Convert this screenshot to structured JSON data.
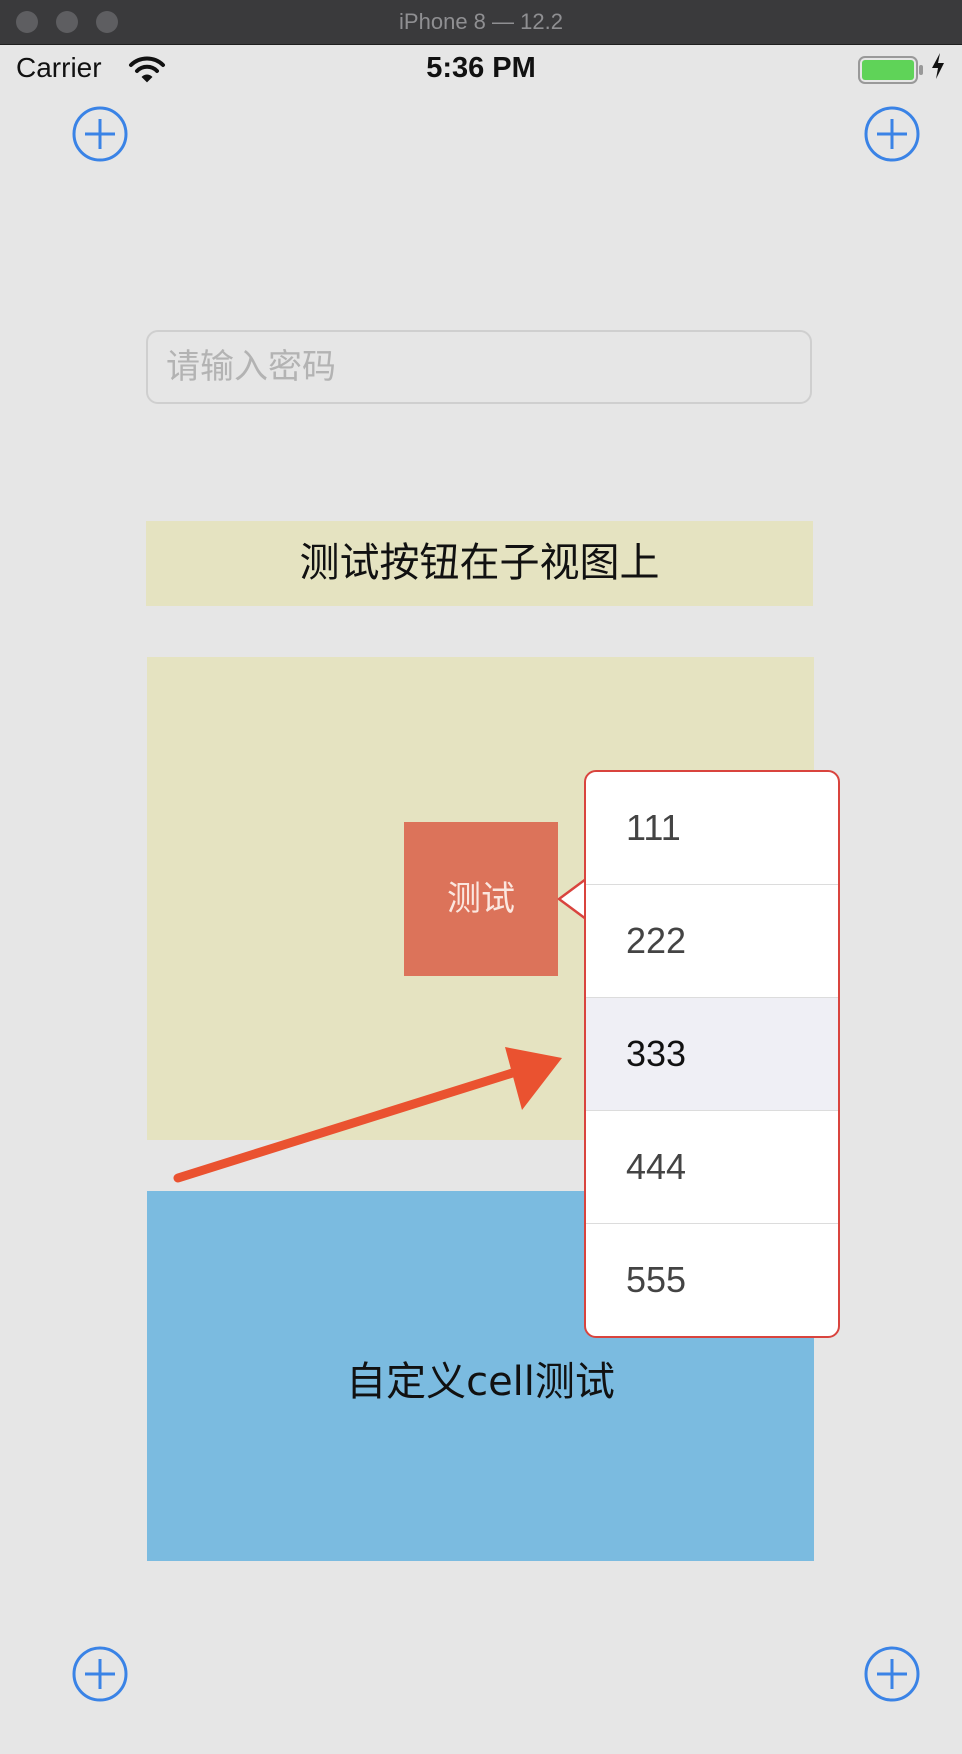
{
  "window": {
    "title": "iPhone 8 — 12.2"
  },
  "statusbar": {
    "carrier": "Carrier",
    "time": "5:36 PM",
    "wifi_icon": "wifi-icon",
    "battery_icon": "battery-icon"
  },
  "password": {
    "placeholder": "请输入密码",
    "value": ""
  },
  "label_bar": {
    "text": "测试按钮在子视图上"
  },
  "test_button": {
    "label": "测试"
  },
  "cell_panel": {
    "label": "自定义cell测试"
  },
  "popover_menu": {
    "items": [
      "111",
      "222",
      "333",
      "444",
      "555"
    ],
    "selected_index": 2
  },
  "icons": {
    "corner_buttons": "plus-circle-icon",
    "annotation": "red-arrow-icon"
  },
  "colors": {
    "accent": "#3a83e6",
    "panel_yellow": "#e5e3c1",
    "button_orange": "#dc735a",
    "panel_blue": "#7bbbe0",
    "popover_border": "#d9443e",
    "annotation_red": "#ea5230"
  }
}
